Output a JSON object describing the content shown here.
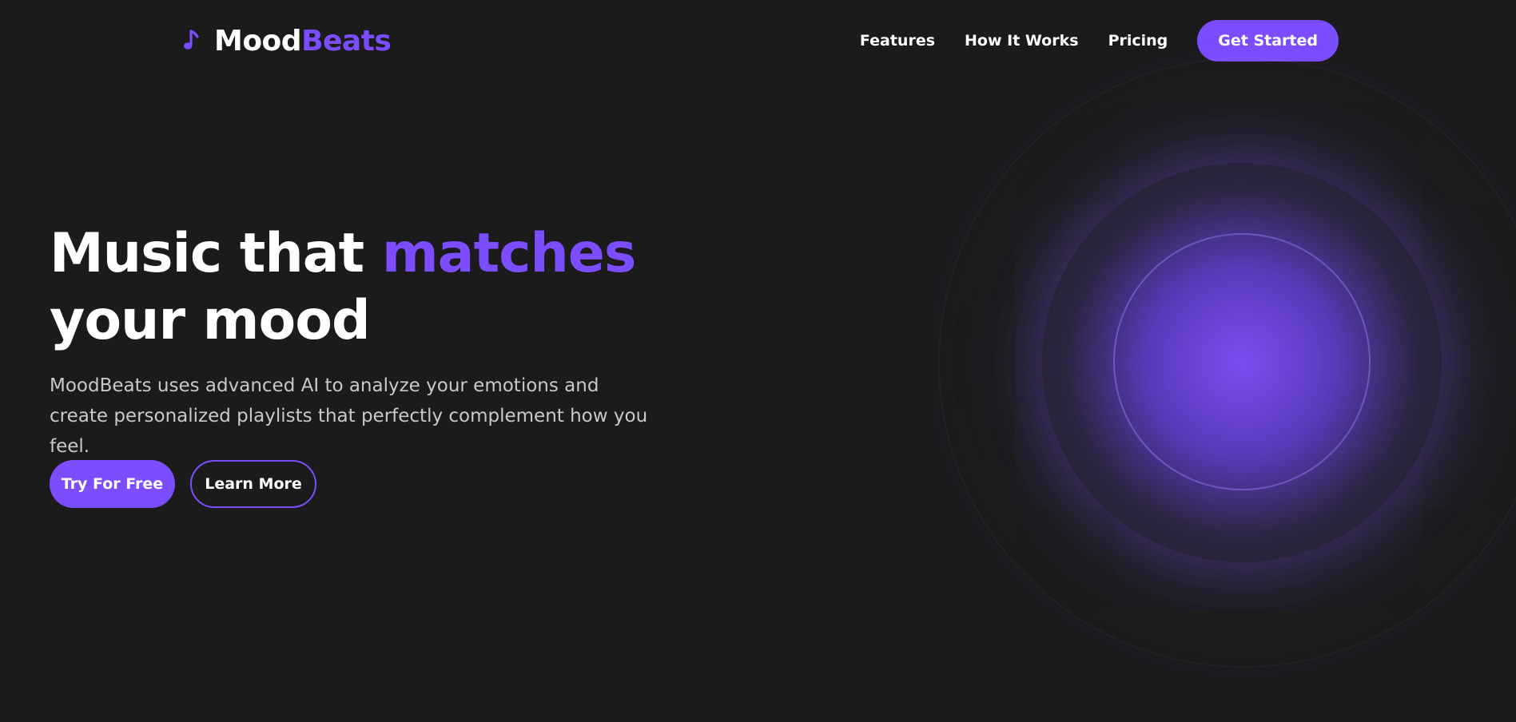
{
  "brand": {
    "name_part1": "Mood",
    "name_part2": "Beats",
    "icon": "music-note-icon",
    "accent_color": "#7c4dff"
  },
  "nav": {
    "items": [
      {
        "label": "Features"
      },
      {
        "label": "How It Works"
      },
      {
        "label": "Pricing"
      }
    ],
    "cta_label": "Get Started"
  },
  "hero": {
    "title_prefix": "Music that ",
    "title_accent": "matches",
    "title_suffix": "your mood",
    "description": "MoodBeats uses advanced AI to analyze your emotions and create personalized playlists that perfectly complement how you feel.",
    "primary_button": "Try For Free",
    "secondary_button": "Learn More"
  },
  "colors": {
    "background": "#1b1b1c",
    "accent": "#7c4dff",
    "text": "#ffffff"
  }
}
